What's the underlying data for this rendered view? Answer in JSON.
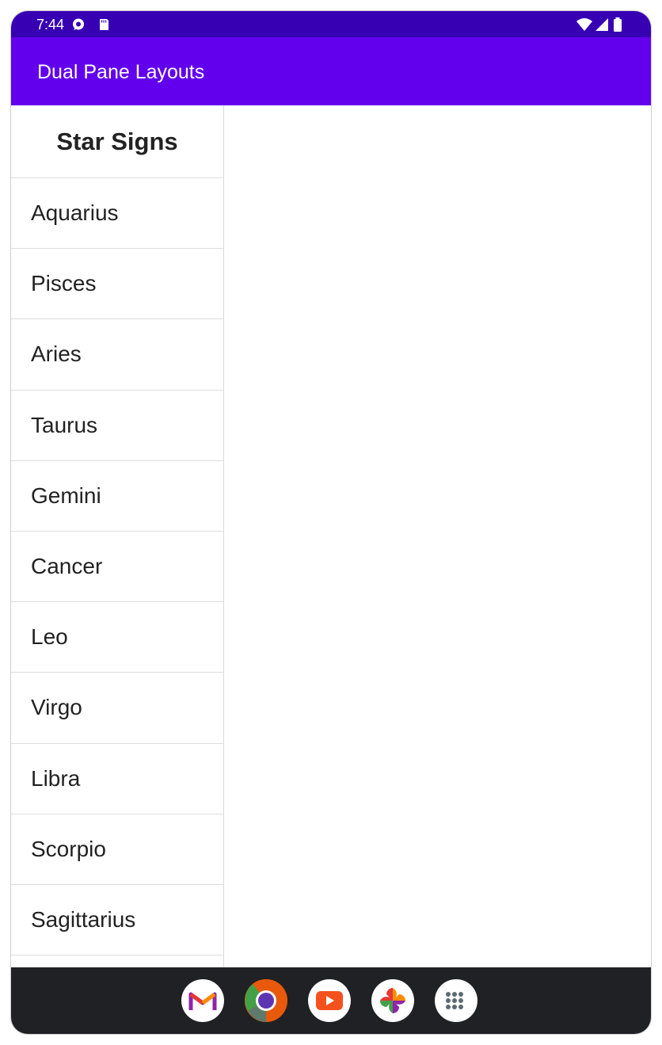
{
  "status_bar": {
    "time": "7:44",
    "left_icons": [
      "chat-bubble-icon",
      "sd-card-icon"
    ],
    "right_icons": [
      "wifi-icon",
      "cell-signal-icon",
      "battery-icon"
    ]
  },
  "app_bar": {
    "title": "Dual Pane Layouts",
    "color": "#6200ee",
    "status_color": "#3700b3"
  },
  "list": {
    "header": "Star Signs",
    "items": [
      "Aquarius",
      "Pisces",
      "Aries",
      "Taurus",
      "Gemini",
      "Cancer",
      "Leo",
      "Virgo",
      "Libra",
      "Scorpio",
      "Sagittarius"
    ]
  },
  "dock": {
    "apps": [
      "gmail-icon",
      "chrome-icon",
      "youtube-icon",
      "photos-icon",
      "app-drawer-icon"
    ]
  }
}
